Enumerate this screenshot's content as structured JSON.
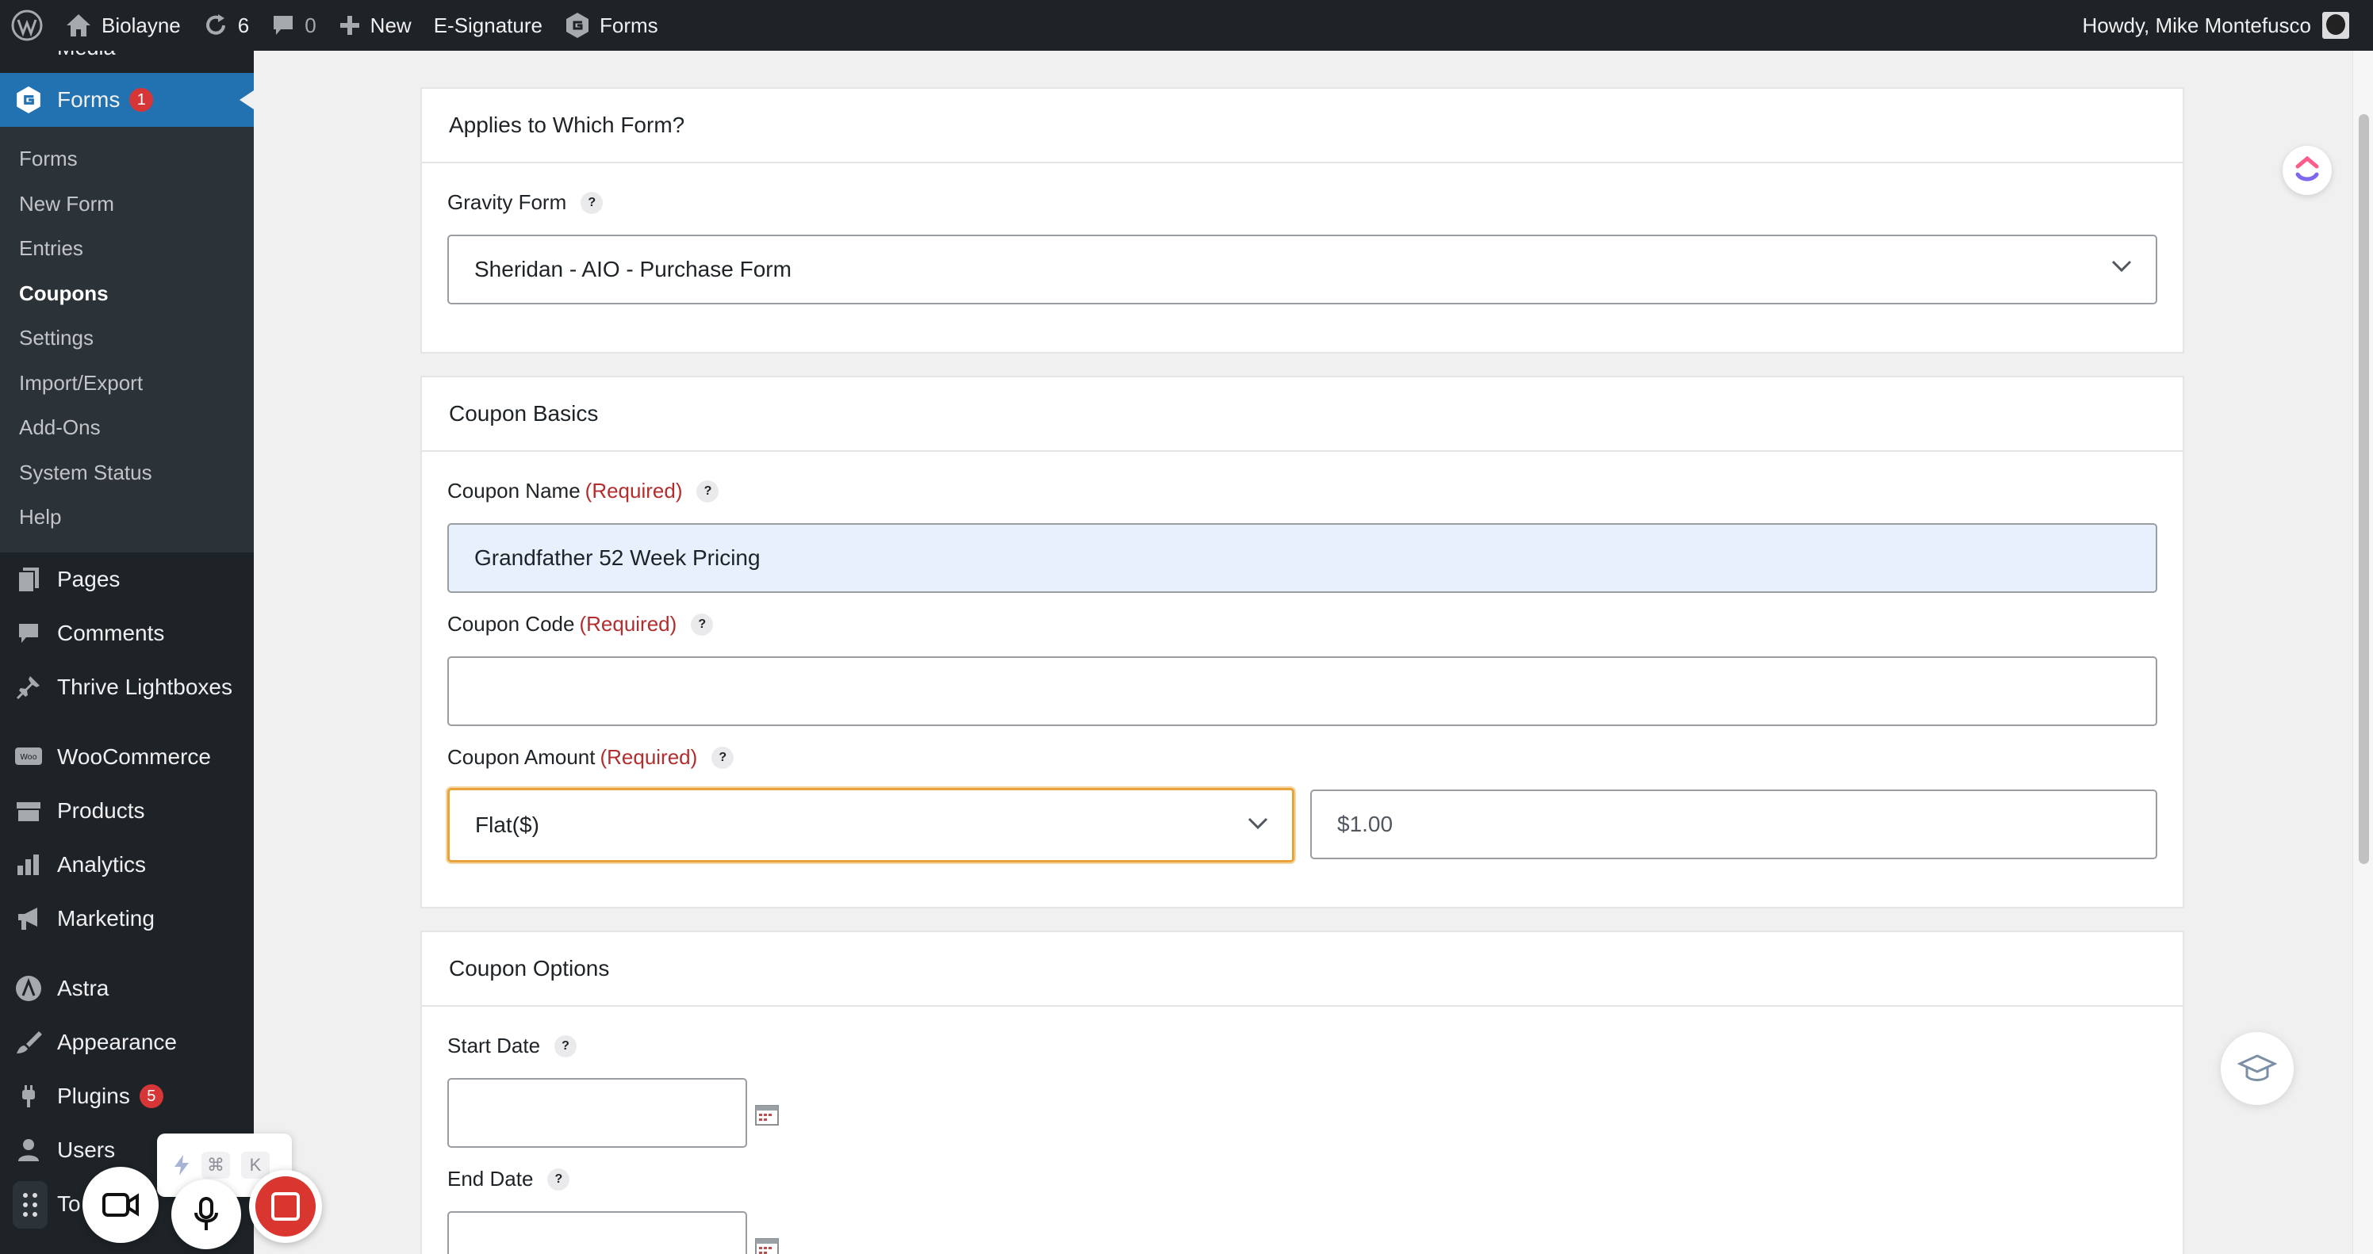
{
  "admin_bar": {
    "site_name": "Biolayne",
    "updates_count": "6",
    "comments_count": "0",
    "new_label": "New",
    "esignature_label": "E-Signature",
    "forms_label": "Forms",
    "greeting": "Howdy, Mike Montefusco"
  },
  "sidebar": {
    "cutoff_label": "Media",
    "forms": {
      "label": "Forms",
      "badge": "1"
    },
    "submenu": [
      {
        "label": "Forms"
      },
      {
        "label": "New Form"
      },
      {
        "label": "Entries"
      },
      {
        "label": "Coupons"
      },
      {
        "label": "Settings"
      },
      {
        "label": "Import/Export"
      },
      {
        "label": "Add-Ons"
      },
      {
        "label": "System Status"
      },
      {
        "label": "Help"
      }
    ],
    "pages": "Pages",
    "comments": "Comments",
    "thrive": "Thrive Lightboxes",
    "woocommerce": "WooCommerce",
    "products": "Products",
    "analytics": "Analytics",
    "marketing": "Marketing",
    "astra": "Astra",
    "appearance": "Appearance",
    "plugins": {
      "label": "Plugins",
      "badge": "5"
    },
    "users": "Users",
    "tools_partial": "To"
  },
  "form_box": {
    "title": "Applies to Which Form?",
    "gravity_form_label": "Gravity Form",
    "help": "?",
    "gravity_form_value": "Sheridan - AIO - Purchase Form"
  },
  "basics_box": {
    "title": "Coupon Basics",
    "coupon_name_label": "Coupon Name",
    "coupon_code_label": "Coupon Code",
    "coupon_amount_label": "Coupon Amount",
    "required": "(Required)",
    "help": "?",
    "coupon_name_value": "Grandfather 52 Week Pricing",
    "coupon_code_value": "",
    "amount_type_value": "Flat($)",
    "amount_placeholder": "$1.00"
  },
  "options_box": {
    "title": "Coupon Options",
    "start_date_label": "Start Date",
    "end_date_label": "End Date",
    "help": "?"
  },
  "recorder": {
    "kbd_cmd": "⌘",
    "kbd_k": "K"
  },
  "colors": {
    "admin_bar_bg": "#1d2327",
    "menu_active": "#2271b1",
    "required_red": "#b32d2e",
    "focus_orange": "#e8a33b",
    "badge_red": "#d63638"
  }
}
